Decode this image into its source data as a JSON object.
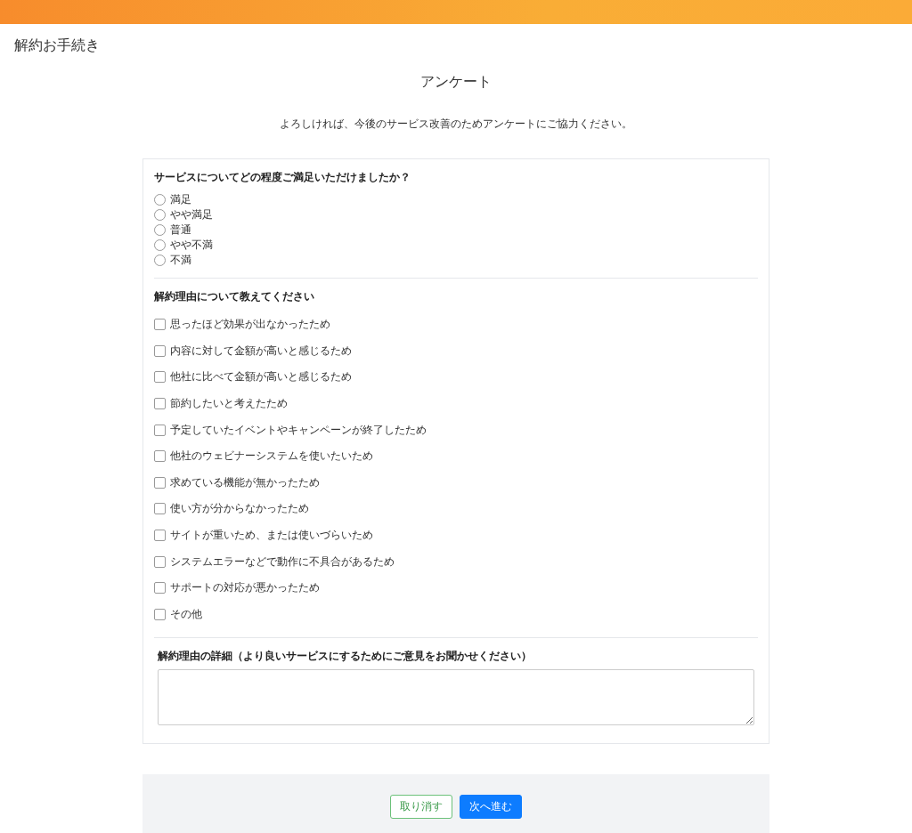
{
  "page_title": "解約お手続き",
  "survey": {
    "heading": "アンケート",
    "intro": "よろしければ、今後のサービス改善のためアンケートにご協力ください。",
    "satisfaction": {
      "question": "サービスについてどの程度ご満足いただけましたか？",
      "options": [
        {
          "label": "満足",
          "selected": false
        },
        {
          "label": "やや満足",
          "selected": false
        },
        {
          "label": "普通",
          "selected": false
        },
        {
          "label": "やや不満",
          "selected": false
        },
        {
          "label": "不満",
          "selected": false
        }
      ]
    },
    "reasons": {
      "question": "解約理由について教えてください",
      "options": [
        {
          "label": "思ったほど効果が出なかったため",
          "checked": false
        },
        {
          "label": "内容に対して金額が高いと感じるため",
          "checked": false
        },
        {
          "label": "他社に比べて金額が高いと感じるため",
          "checked": false
        },
        {
          "label": "節約したいと考えたため",
          "checked": false
        },
        {
          "label": "予定していたイベントやキャンペーンが終了したため",
          "checked": false
        },
        {
          "label": "他社のウェビナーシステムを使いたいため",
          "checked": false
        },
        {
          "label": "求めている機能が無かったため",
          "checked": false
        },
        {
          "label": "使い方が分からなかったため",
          "checked": false
        },
        {
          "label": "サイトが重いため、または使いづらいため",
          "checked": false
        },
        {
          "label": "システムエラーなどで動作に不具合があるため",
          "checked": false
        },
        {
          "label": "サポートの対応が悪かったため",
          "checked": false
        },
        {
          "label": "その他",
          "checked": false
        }
      ]
    },
    "details": {
      "label": "解約理由の詳細（より良いサービスにするためにご意見をお聞かせください）"
    }
  },
  "actions": {
    "cancel": "取り消す",
    "next": "次へ進む"
  }
}
